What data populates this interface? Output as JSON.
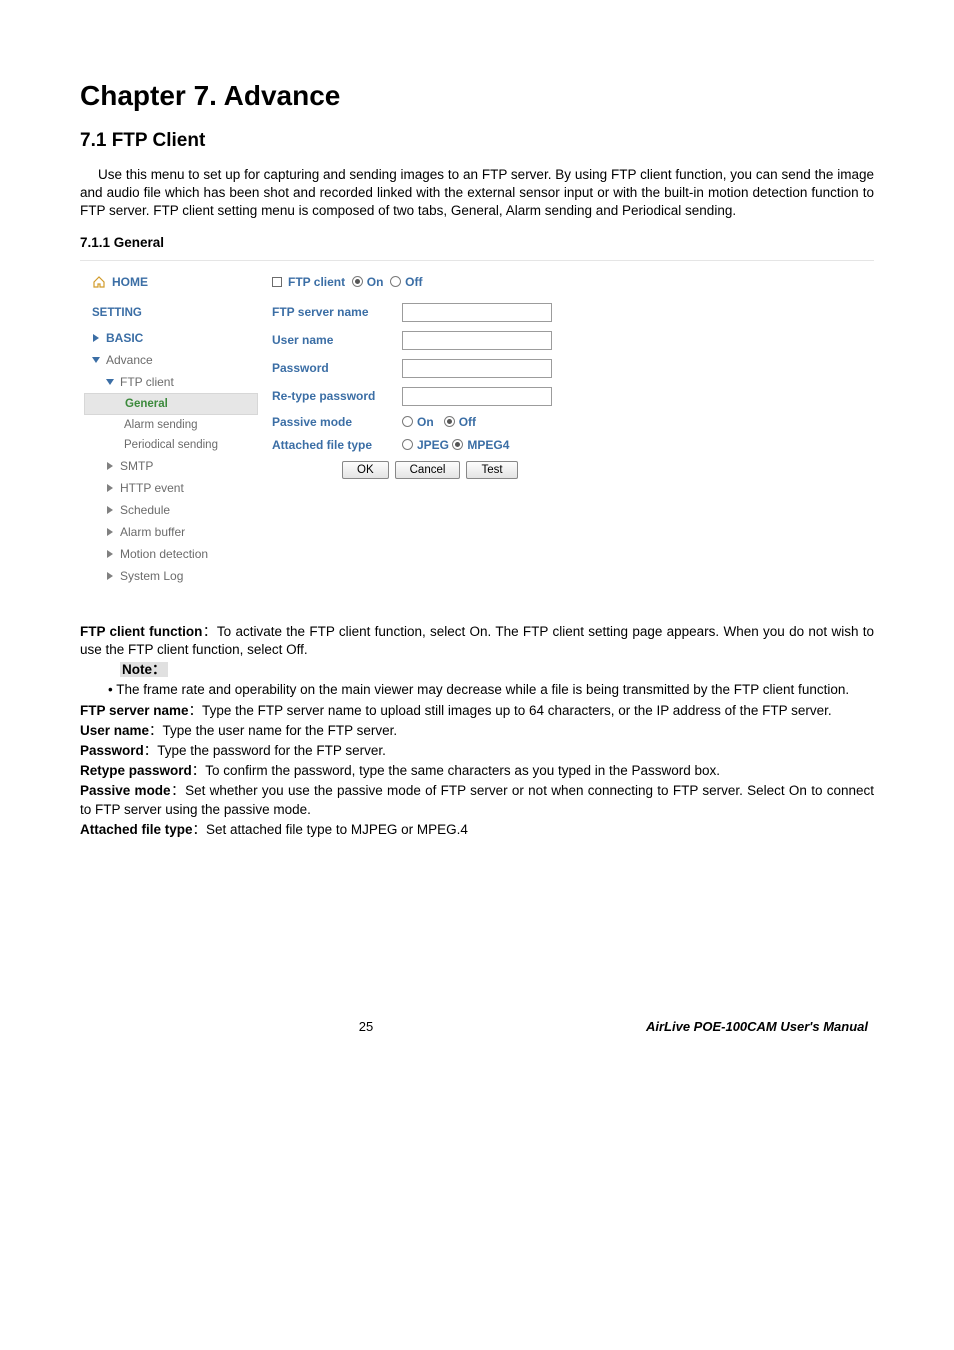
{
  "chapter_title": "Chapter 7. Advance",
  "section_title": "7.1 FTP Client",
  "intro": "Use this menu to set up for capturing and sending images to an FTP server. By using FTP client function, you can send the image and audio file which has been shot and recorded linked with the external sensor input or with the built-in motion detection function to FTP server. FTP client setting menu is composed of two tabs, General, Alarm sending and Periodical sending.",
  "subsection": "7.1.1 General",
  "sidebar": {
    "home": "HOME",
    "setting": "SETTING",
    "basic": "BASIC",
    "advance": "Advance",
    "ftp_client": "FTP client",
    "general": "General",
    "alarm_sending": "Alarm sending",
    "periodical_sending": "Periodical sending",
    "smtp": "SMTP",
    "http_event": "HTTP event",
    "schedule": "Schedule",
    "alarm_buffer": "Alarm buffer",
    "motion_detection": "Motion detection",
    "system_log": "System Log"
  },
  "form": {
    "top_label": "FTP client",
    "on": "On",
    "off": "Off",
    "server_name": "FTP server name",
    "user_name": "User name",
    "password": "Password",
    "retype": "Re-type password",
    "passive": "Passive mode",
    "attached": "Attached file type",
    "jpeg": "JPEG",
    "mpeg4": "MPEG4",
    "ok": "OK",
    "cancel": "Cancel",
    "test": "Test"
  },
  "desc": {
    "ftp_client_label": "FTP client function",
    "ftp_client_text": "：To activate the FTP client function, select On. The FTP client setting page appears. When you do not wish to use the FTP client function, select Off.",
    "note_label": "Note：",
    "note_bullet": "• The frame rate and operability on the main viewer may decrease while a file is being transmitted by the FTP client function.",
    "server_label": "FTP server name",
    "server_text": "：Type the FTP server name to upload still images up to 64 characters, or the IP address of the FTP server.",
    "user_label": "User name",
    "user_text": "：Type the user name for the FTP server.",
    "pass_label": "Password",
    "pass_text": "：Type the password for the FTP server.",
    "retype_label": "Retype password",
    "retype_text": "：To confirm the password, type the same characters as you typed in the Password box.",
    "passive_label": "Passive mode",
    "passive_text": "：Set whether you use the passive mode of FTP server or not when connecting to FTP server. Select On to connect to FTP server using the passive mode.",
    "attached_label": "Attached file type",
    "attached_text": "：Set attached file type to MJPEG or MPEG.4"
  },
  "footer": {
    "page": "25",
    "manual": "AirLive POE-100CAM  User's Manual"
  }
}
